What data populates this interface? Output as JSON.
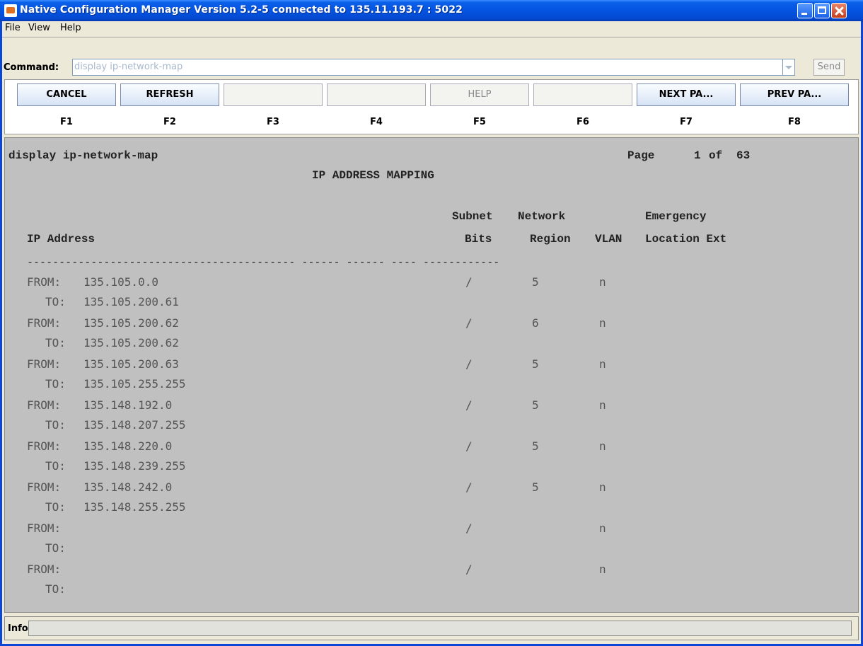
{
  "window": {
    "title": "Native Configuration Manager Version 5.2-5 connected to 135.11.193.7 : 5022"
  },
  "menu": [
    "File",
    "View",
    "Help"
  ],
  "command": {
    "label": "Command:",
    "value": "display ip-network-map",
    "send_label": "Send"
  },
  "function_keys": [
    {
      "label": "CANCEL",
      "key": "F1"
    },
    {
      "label": "REFRESH",
      "key": "F2"
    },
    {
      "label": "",
      "key": "F3"
    },
    {
      "label": "",
      "key": "F4"
    },
    {
      "label": "HELP",
      "key": "F5"
    },
    {
      "label": "",
      "key": "F6"
    },
    {
      "label": "NEXT  PA...",
      "key": "F7"
    },
    {
      "label": "PREV  PA...",
      "key": "F8"
    }
  ],
  "screen": {
    "command_echo": "display ip-network-map",
    "page_label": "Page",
    "page_current": "1",
    "page_of": "of",
    "page_total": "63",
    "heading": "IP ADDRESS MAPPING",
    "columns": {
      "ip_address": "IP Address",
      "subnet_top": "Subnet",
      "subnet_bottom": "Bits",
      "network_top": "Network",
      "network_bottom": "Region",
      "vlan": "VLAN",
      "emergency_top": "Emergency",
      "emergency_bottom": "Location Ext"
    },
    "rows": [
      {
        "from_label": "FROM:",
        "from": "135.105.0.0",
        "to_label": "TO:",
        "to": "135.105.200.61",
        "bits": "/",
        "region": "5",
        "vlan": "n"
      },
      {
        "from_label": "FROM:",
        "from": "135.105.200.62",
        "to_label": "TO:",
        "to": "135.105.200.62",
        "bits": "/",
        "region": "6",
        "vlan": "n"
      },
      {
        "from_label": "FROM:",
        "from": "135.105.200.63",
        "to_label": "TO:",
        "to": "135.105.255.255",
        "bits": "/",
        "region": "5",
        "vlan": "n"
      },
      {
        "from_label": "FROM:",
        "from": "135.148.192.0",
        "to_label": "TO:",
        "to": "135.148.207.255",
        "bits": "/",
        "region": "5",
        "vlan": "n"
      },
      {
        "from_label": "FROM:",
        "from": "135.148.220.0",
        "to_label": "TO:",
        "to": "135.148.239.255",
        "bits": "/",
        "region": "5",
        "vlan": "n"
      },
      {
        "from_label": "FROM:",
        "from": "135.148.242.0",
        "to_label": "TO:",
        "to": "135.148.255.255",
        "bits": "/",
        "region": "5",
        "vlan": "n"
      },
      {
        "from_label": "FROM:",
        "from": "",
        "to_label": "TO:",
        "to": "",
        "bits": "/",
        "region": "",
        "vlan": "n"
      },
      {
        "from_label": "FROM:",
        "from": "",
        "to_label": "TO:",
        "to": "",
        "bits": "/",
        "region": "",
        "vlan": "n"
      }
    ]
  },
  "info": {
    "label": "Info:",
    "value": ""
  }
}
